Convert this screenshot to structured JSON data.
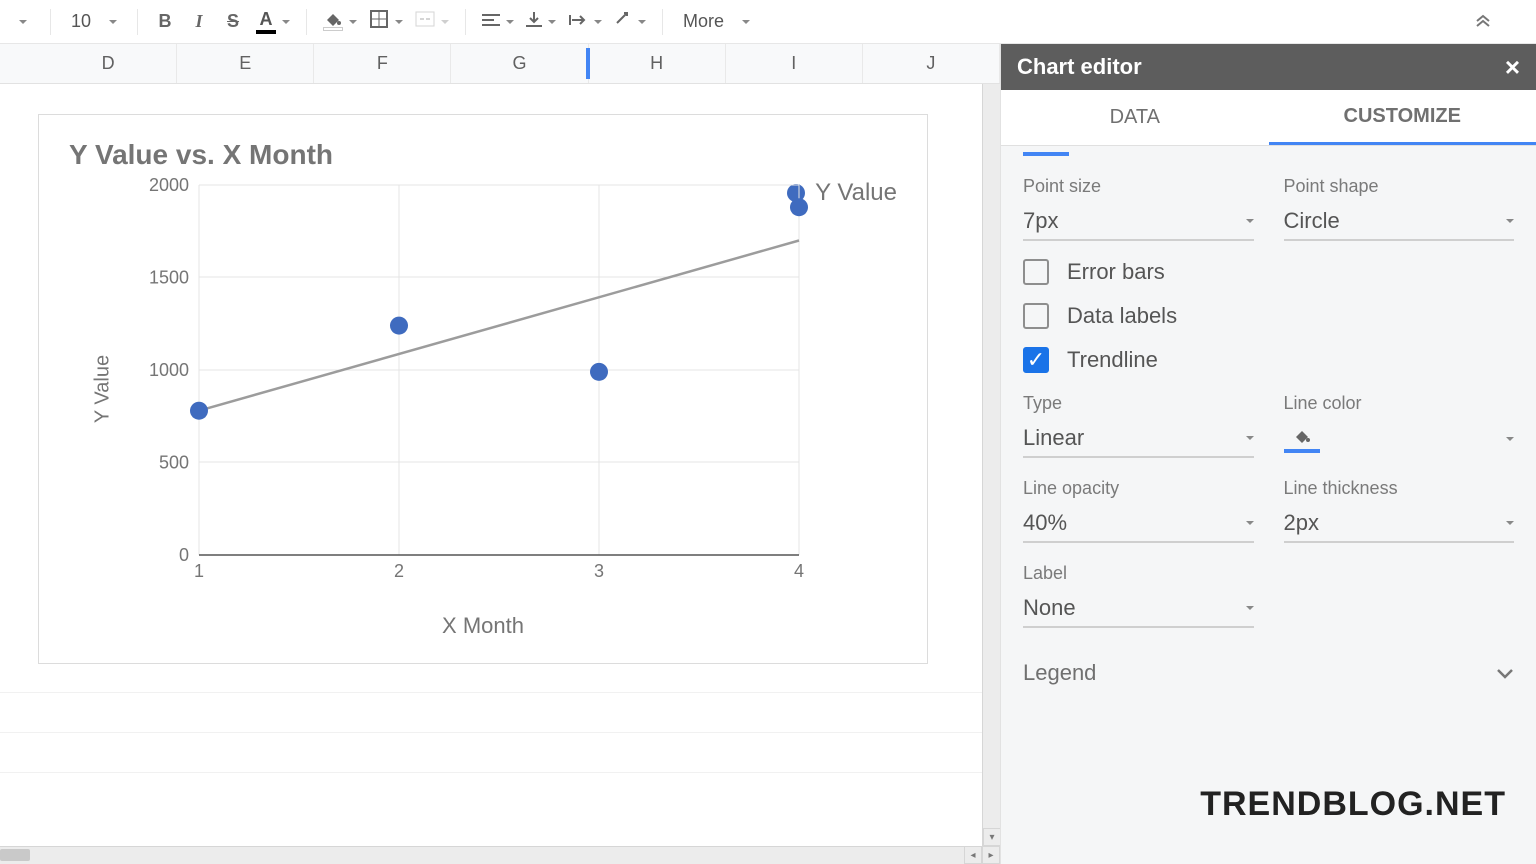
{
  "toolbar": {
    "font_size": "10",
    "more": "More"
  },
  "columns": [
    "D",
    "E",
    "F",
    "G",
    "H",
    "I",
    "J"
  ],
  "selected_col": "G",
  "chart_data": {
    "type": "scatter",
    "title": "Y Value vs. X Month",
    "xlabel": "X Month",
    "ylabel": "Y Value",
    "x": [
      1,
      2,
      3,
      4
    ],
    "y": [
      780,
      1240,
      990,
      1880
    ],
    "xlim": [
      1,
      4
    ],
    "ylim": [
      0,
      2000
    ],
    "yticks": [
      0,
      500,
      1000,
      1500,
      2000
    ],
    "xticks": [
      1,
      2,
      3,
      4
    ],
    "series": [
      {
        "name": "Y Value"
      }
    ],
    "trendline": {
      "type": "Linear",
      "p1": {
        "x": 1,
        "y": 780
      },
      "p2": {
        "x": 4,
        "y": 1700
      }
    }
  },
  "sidebar": {
    "title": "Chart editor",
    "tabs": {
      "data": "DATA",
      "customize": "CUSTOMIZE"
    },
    "point_size": {
      "label": "Point size",
      "value": "7px"
    },
    "point_shape": {
      "label": "Point shape",
      "value": "Circle"
    },
    "error_bars": "Error bars",
    "data_labels": "Data labels",
    "trendline": "Trendline",
    "type": {
      "label": "Type",
      "value": "Linear"
    },
    "line_color": {
      "label": "Line color"
    },
    "line_opacity": {
      "label": "Line opacity",
      "value": "40%"
    },
    "line_thickness": {
      "label": "Line thickness",
      "value": "2px"
    },
    "trend_label": {
      "label": "Label",
      "value": "None"
    },
    "legend_section": "Legend"
  },
  "watermark": "TRENDBLOG.NET"
}
